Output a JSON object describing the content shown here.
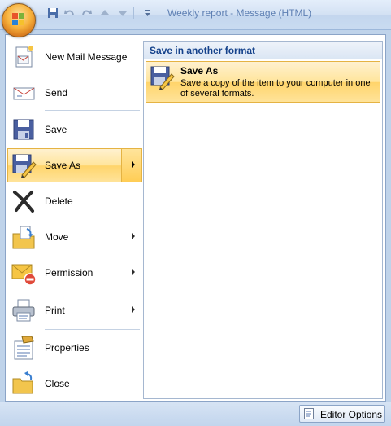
{
  "window": {
    "title": "Weekly report - Message (HTML)"
  },
  "quick_access": {
    "icons": [
      "save-icon",
      "undo-icon",
      "redo-icon",
      "previous-item-icon",
      "next-item-icon",
      "customize-qat-icon"
    ]
  },
  "menu": {
    "items": [
      {
        "label": "New Mail Message",
        "icon": "new-mail-icon",
        "has_submenu": false
      },
      {
        "label": "Send",
        "icon": "send-icon",
        "has_submenu": false
      },
      {
        "label": "Save",
        "icon": "save-icon",
        "has_submenu": false
      },
      {
        "label": "Save As",
        "icon": "save-as-icon",
        "has_submenu": true,
        "highlighted": true
      },
      {
        "label": "Delete",
        "icon": "delete-icon",
        "has_submenu": false
      },
      {
        "label": "Move",
        "icon": "move-icon",
        "has_submenu": true
      },
      {
        "label": "Permission",
        "icon": "permission-icon",
        "has_submenu": true
      },
      {
        "label": "Print",
        "icon": "print-icon",
        "has_submenu": true
      },
      {
        "label": "Properties",
        "icon": "properties-icon",
        "has_submenu": false
      },
      {
        "label": "Close",
        "icon": "close-folder-icon",
        "has_submenu": false
      }
    ]
  },
  "submenu": {
    "header": "Save in another format",
    "item": {
      "title": "Save As",
      "description": "Save a copy of the item to your computer in one of several formats."
    }
  },
  "footer": {
    "editor_options_label": "Editor Options"
  },
  "colors": {
    "highlight": "#ffd46a",
    "header_text": "#15428b",
    "title_text": "#5d7fb3"
  }
}
